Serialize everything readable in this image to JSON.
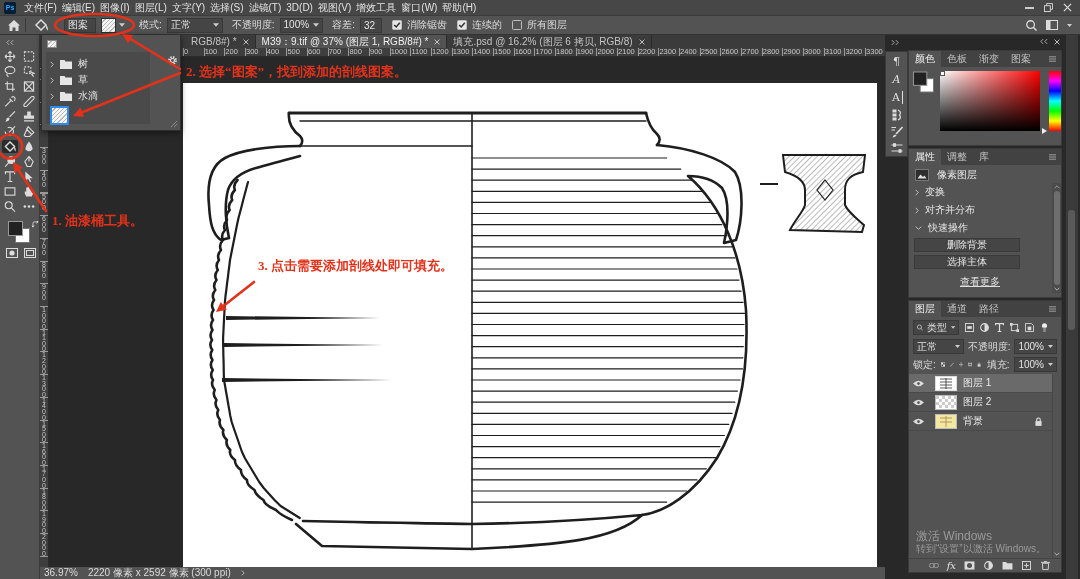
{
  "app": {
    "logo": "Ps"
  },
  "menu_bar": [
    "文件(F)",
    "编辑(E)",
    "图像(I)",
    "图层(L)",
    "文字(Y)",
    "选择(S)",
    "滤镜(T)",
    "3D(D)",
    "视图(V)",
    "增效工具",
    "窗口(W)",
    "帮助(H)"
  ],
  "options_bar": {
    "fill_source": "图案",
    "mode_label": "模式:",
    "mode": "正常",
    "opacity_label": "不透明度:",
    "opacity": "100%",
    "tolerance_label": "容差:",
    "tolerance": "32",
    "checkboxes": [
      {
        "label": "消除锯齿",
        "checked": true
      },
      {
        "label": "连续的",
        "checked": true
      },
      {
        "label": "所有图层",
        "checked": false
      }
    ]
  },
  "document_tabs": [
    {
      "title": "RGB/8#) *",
      "selected": false
    },
    {
      "title": "M39：9.tif @ 37% (图层 1, RGB/8#) *",
      "selected": true
    },
    {
      "title": "填充.psd @ 16.2% (图层 6 拷贝, RGB/8)",
      "selected": false
    }
  ],
  "pattern_picker": {
    "groups": [
      {
        "name": "树",
        "expanded": false
      },
      {
        "name": "草",
        "expanded": false
      },
      {
        "name": "水滴",
        "expanded": false
      }
    ],
    "patterns": [
      {
        "selected": true
      }
    ]
  },
  "tools": [
    {
      "selected": false
    },
    {
      "selected": false
    },
    {
      "selected": false
    },
    {
      "selected": false
    },
    {
      "selected": false
    },
    {
      "selected": false
    },
    {
      "selected": false
    },
    {
      "selected": false
    },
    {
      "selected": false
    },
    {
      "selected": false
    },
    {
      "selected": false
    },
    {
      "selected": false
    },
    {
      "selected": true
    },
    {
      "selected": false
    },
    {
      "selected": false
    },
    {
      "selected": false
    },
    {
      "selected": false
    },
    {
      "selected": false
    },
    {
      "selected": false
    },
    {
      "selected": false
    },
    {
      "selected": false
    },
    {
      "selected": false
    }
  ],
  "rulers": {
    "horizontal": [
      "0",
      "100",
      "200",
      "300",
      "400",
      "500",
      "600",
      "700",
      "800",
      "900",
      "1000",
      "1100",
      "1200",
      "1300",
      "1400",
      "1500",
      "1600",
      "1700",
      "1800",
      "1900",
      "2000",
      "2100",
      "2200",
      "2300",
      "2400",
      "2500",
      "2600",
      "2700",
      "2800",
      "2900",
      "3000",
      "3100",
      "3200",
      "3300"
    ],
    "vertical": [
      "300",
      "400",
      "500",
      "600",
      "700",
      "800",
      "900",
      "1000",
      "1100",
      "1200",
      "1300",
      "1400",
      "1500",
      "1600",
      "1700",
      "1800",
      "1900",
      "2000"
    ]
  },
  "annotations": [
    {
      "text": "2. 选择“图案”，找到添加的剖线图案。"
    },
    {
      "text": "1. 油漆桶工具。"
    },
    {
      "text": "3. 点击需要添加剖线处即可填充。"
    }
  ],
  "dock_glyphs": [
    "¶",
    "A",
    "A"
  ],
  "color_panel": {
    "tabs": [
      {
        "label": "颜色",
        "selected": true
      },
      {
        "label": "色板",
        "selected": false
      },
      {
        "label": "渐变",
        "selected": false
      },
      {
        "label": "图案",
        "selected": false
      }
    ],
    "hue": {
      "level": 0
    }
  },
  "properties_panel": {
    "tabs": [
      {
        "label": "属性",
        "selected": true
      },
      {
        "label": "调整",
        "selected": false
      },
      {
        "label": "库",
        "selected": false
      }
    ],
    "layer_type": "像素图层",
    "sections": [
      {
        "title": "变换",
        "expanded": false
      },
      {
        "title": "对齐并分布",
        "expanded": false
      },
      {
        "title": "快速操作",
        "expanded": true
      }
    ],
    "actions": [
      "删除背景",
      "选择主体"
    ],
    "more_link": "查看更多"
  },
  "layers_panel": {
    "tabs": [
      {
        "label": "图层",
        "selected": true
      },
      {
        "label": "通道",
        "selected": false
      },
      {
        "label": "路径",
        "selected": false
      }
    ],
    "filter": "类型",
    "blend_mode": "正常",
    "opacity_label": "不透明度:",
    "opacity": "100%",
    "lock_label": "锁定:",
    "fill_label": "填充:",
    "fill": "100%",
    "layers": [
      {
        "name": "图层 1",
        "kind": "line-art",
        "selected": true,
        "visible": true,
        "locked": false
      },
      {
        "name": "图层 2",
        "kind": "transparent",
        "selected": false,
        "visible": true,
        "locked": false
      },
      {
        "name": "背景",
        "kind": "background",
        "selected": false,
        "visible": true,
        "locked": true
      }
    ],
    "effects_label": "fx"
  },
  "status_bar": {
    "zoom": "36.97%",
    "document_size": "2220 像素 x 2592 像素 (300 ppi)"
  },
  "windows_notice": {
    "title": "激活 Windows",
    "message": "转到“设置”以激活 Windows。"
  }
}
